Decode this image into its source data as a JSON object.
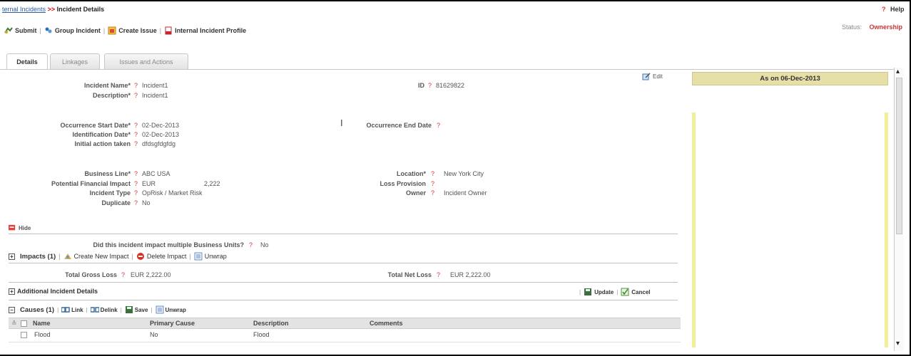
{
  "breadcrumb": {
    "parent": "ternal Incidents",
    "separator": ">>",
    "current": "Incident Details"
  },
  "help": {
    "q": "?",
    "label": "Help"
  },
  "status": {
    "label": "Status:",
    "value": "Ownership"
  },
  "toolbar": {
    "submit": "Submit",
    "group_incident": "Group Incident",
    "create_issue": "Create Issue",
    "internal_profile": "Internal Incident Profile",
    "sep": "|"
  },
  "tabs": [
    "Details",
    "Linkages",
    "Issues and Actions"
  ],
  "edit_label": "Edit",
  "q": "?",
  "fields": {
    "incident_name": {
      "label": "Incident Name*",
      "value": "Incident1"
    },
    "description": {
      "label": "Description*",
      "value": "Incident1"
    },
    "id": {
      "label": "ID",
      "value": "81629822"
    },
    "occ_start": {
      "label": "Occurrence Start Date*",
      "value": "02-Dec-2013"
    },
    "ident_date": {
      "label": "Identification Date*",
      "value": "02-Dec-2013"
    },
    "initial_action": {
      "label": "Initial action taken",
      "value": "dfdsgfdgfdg"
    },
    "occ_end": {
      "label": "Occurrence End Date",
      "value": ""
    },
    "business_line": {
      "label": "Business Line*",
      "value": "ABC USA"
    },
    "pot_fin_impact": {
      "label": "Potential Financial Impact",
      "currency": "EUR",
      "value": "2,222"
    },
    "incident_type": {
      "label": "Incident Type",
      "value": "OpRisk / Market Risk"
    },
    "duplicate": {
      "label": "Duplicate",
      "value": "No"
    },
    "location": {
      "label": "Location*",
      "value": "New York City"
    },
    "loss_provision": {
      "label": "Loss Provision",
      "value": ""
    },
    "owner": {
      "label": "Owner",
      "value": "Incident Owner"
    }
  },
  "hide_label": "Hide",
  "multi_bu": {
    "label": "Did this incident impact multiple Business Units?",
    "value": "No"
  },
  "impacts": {
    "title": "Impacts (1)",
    "create": "Create New Impact",
    "delete": "Delete Impact",
    "unwrap": "Unwrap",
    "total_gross": {
      "label": "Total Gross Loss",
      "value": "EUR 2,222.00"
    },
    "total_net": {
      "label": "Total Net Loss",
      "value": "EUR 2,222.00"
    }
  },
  "additional": {
    "title": "Additional Incident Details",
    "update": "Update",
    "cancel": "Cancel"
  },
  "causes": {
    "title": "Causes (1)",
    "link": "Link",
    "delink": "Delink",
    "save": "Save",
    "unwrap": "Unwrap",
    "columns": [
      "Name",
      "Primary Cause",
      "Description",
      "Comments"
    ],
    "rows": [
      {
        "name": "Flood",
        "primary": "No",
        "description": "Flood",
        "comments": ""
      }
    ]
  },
  "right_panel": {
    "as_on": "As on 06-Dec-2013"
  },
  "colors": {
    "accent_red": "#d33333",
    "panel_yellow": "#e6e0a8",
    "link_blue": "#2a5ca8"
  }
}
